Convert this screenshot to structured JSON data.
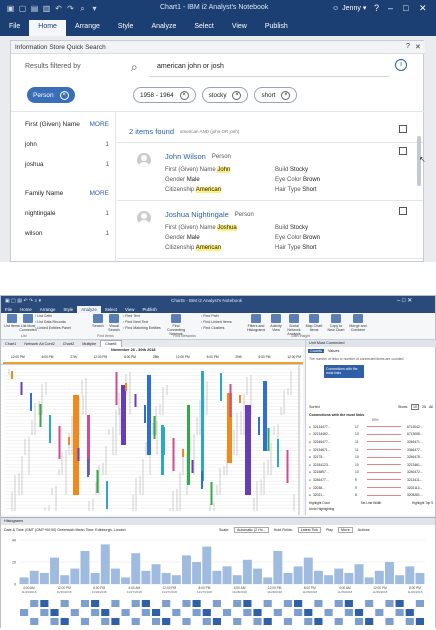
{
  "top": {
    "window_title": "Chart1 - IBM i2 Analyst's Notebook",
    "user": "Jenny",
    "menu": [
      "File",
      "Home",
      "Arrange",
      "Style",
      "Analyze",
      "Select",
      "View",
      "Publish"
    ],
    "active_menu": "Home",
    "panel_title": "Information Store Quick Search",
    "results_filtered_by": "Results filtered by",
    "filter_chip": "Person",
    "search_value": "american john or josh",
    "chips": [
      "1958 - 1964",
      "stocky",
      "short"
    ],
    "facets": [
      {
        "title": "First (Given) Name",
        "more": "MORE",
        "items": [
          {
            "label": "john",
            "count": "1"
          },
          {
            "label": "joshua",
            "count": "1"
          }
        ]
      },
      {
        "title": "Family Name",
        "more": "MORE",
        "items": [
          {
            "label": "nightingale",
            "count": "1"
          },
          {
            "label": "wilson",
            "count": "1"
          }
        ]
      }
    ],
    "items_found": "2 items found",
    "items_found_note": "american AND (john OR josh)",
    "results": [
      {
        "name": "John Wilson",
        "type": "Person",
        "left": [
          {
            "k": "First (Given) Name",
            "v": "John",
            "hl": true
          },
          {
            "k": "Gender",
            "v": "Male",
            "hl": false
          },
          {
            "k": "Citizenship",
            "v": "American",
            "hl": true
          }
        ],
        "right": [
          {
            "k": "Build",
            "v": "Stocky"
          },
          {
            "k": "Eye Color",
            "v": "Brown"
          },
          {
            "k": "Hair Type",
            "v": "Short"
          }
        ]
      },
      {
        "name": "Joshua Nightingale",
        "type": "Person",
        "left": [
          {
            "k": "First (Given) Name",
            "v": "Joshua",
            "hl": true
          },
          {
            "k": "Gender",
            "v": "Male",
            "hl": false
          },
          {
            "k": "Citizenship",
            "v": "American",
            "hl": true
          }
        ],
        "right": [
          {
            "k": "Build",
            "v": "Stocky"
          },
          {
            "k": "Eye Color",
            "v": "Brown"
          },
          {
            "k": "Hair Type",
            "v": "Short"
          }
        ]
      }
    ]
  },
  "bottom": {
    "window_title": "Chart5 - IBM i2 Analyst's Notebook",
    "menu": [
      "File",
      "Home",
      "Arrange",
      "Style",
      "Analyze",
      "Select",
      "View",
      "Publish"
    ],
    "active_menu": "Analyze",
    "ribbon": [
      "List Items",
      "List Most Connected",
      "List Cells",
      "List Data Records",
      "Linked Entities Panel",
      "Search",
      "Visual Search",
      "Find Text",
      "Find Next Text",
      "Find Matching Entities",
      "Find Connecting Network",
      "Find Path",
      "Find Linked Items",
      "Find Clusters",
      "Filters and Histograms",
      "Activity View",
      "Social Network Analysis",
      "Map Chart Items",
      "Copy to New Chart",
      "Merge and Combine"
    ],
    "ribbon_groups": [
      "List",
      "Find Items",
      "Find Networks",
      "Gain Insight"
    ],
    "tabs": [
      "Chart1",
      "Network Ati Cont2",
      "Chart2",
      "Multiplie",
      "Chart5"
    ],
    "timeline_date": "November 26 - 30th 2018",
    "timeline_ticks": [
      "12:00 PM",
      "6:00 PM",
      "27th",
      "12:00 PM",
      "6:00 PM",
      "28th",
      "12:00 PM",
      "6:00 PM",
      "29th",
      "6:00 PM",
      "12:00 PM"
    ],
    "right_panel": {
      "title": "Unit Most Connected",
      "tabs": [
        "Counts",
        "Values"
      ],
      "caption": "The number of links or number of connected items are counted",
      "button": "Connections with the most links",
      "sort_label": "Sorted",
      "show_label": "Show:",
      "show_values": [
        "10",
        "25",
        "All"
      ],
      "table_title": "Connections with the most links",
      "pct": "50%",
      "rows": [
        {
          "l": "32134477...",
          "n": "17",
          "r": "6713042..."
        },
        {
          "l": "32134462...",
          "n": "13",
          "r": "6713068..."
        },
        {
          "l": "32346477...",
          "n": "11",
          "r": "3246471..."
        },
        {
          "l": "32134671...",
          "n": "11",
          "r": "3346477..."
        },
        {
          "l": "32175...",
          "n": "10",
          "r": "3246478..."
        },
        {
          "l": "32184123...",
          "n": "10",
          "r": "3213461..."
        },
        {
          "l": "3215897...",
          "n": "10",
          "r": "3246472..."
        },
        {
          "l": "3246477...",
          "n": "9",
          "r": "3213411..."
        },
        {
          "l": "32038...",
          "n": "9",
          "r": "3202113..."
        },
        {
          "l": "32021...",
          "n": "8",
          "r": "3205281..."
        }
      ],
      "footer": [
        "Highlight Color",
        "Set Line Width",
        "Highlight Top 5"
      ],
      "undo": "Undo Highlighting"
    },
    "histograms": {
      "title": "Histograms",
      "subtitle": "Date & Time (GMT (GMT+00:00) Greenwich Mean Time: Edinburgh, London",
      "scale_label": "Scale:",
      "scale_value": "Automatic (2 Ho...",
      "hold_label": "Hold Fields:",
      "hold_value": "Latest Tick",
      "play": "Play",
      "play_value": "Move",
      "actions": "Actions",
      "y_ticks": [
        "40",
        "20",
        "0"
      ],
      "x_ticks": [
        "4:00 AM",
        "12:00 PM",
        "8:00 PM",
        "4:00 AM",
        "12:00 PM",
        "8:00 PM",
        "4:00 AM",
        "12:00 PM",
        "8:00 PM",
        "4:00 AM",
        "12:00 PM",
        "8:00 PM"
      ],
      "x_dates": [
        "11/26/2018",
        "11/26/2018",
        "11/26/2018",
        "11/27/2018",
        "11/27/2018",
        "11/27/2018",
        "11/28/2018",
        "11/28/2018",
        "11/28/2018",
        "11/29/2018",
        "11/29/2018",
        "11/29/2018"
      ],
      "values": [
        6,
        12,
        10,
        24,
        8,
        14,
        30,
        10,
        36,
        14,
        6,
        28,
        12,
        18,
        10,
        8,
        26,
        20,
        34,
        12,
        16,
        8,
        22,
        14,
        6,
        30,
        10,
        16,
        24,
        12,
        8,
        14,
        10,
        18,
        6,
        12,
        20,
        8,
        16,
        10
      ],
      "ylim": [
        0,
        40
      ]
    }
  }
}
